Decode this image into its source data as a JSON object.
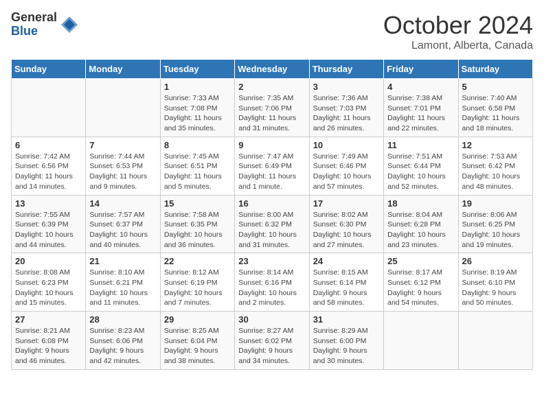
{
  "header": {
    "logo_general": "General",
    "logo_blue": "Blue",
    "month": "October 2024",
    "location": "Lamont, Alberta, Canada"
  },
  "days_of_week": [
    "Sunday",
    "Monday",
    "Tuesday",
    "Wednesday",
    "Thursday",
    "Friday",
    "Saturday"
  ],
  "weeks": [
    [
      {
        "day": "",
        "info": ""
      },
      {
        "day": "",
        "info": ""
      },
      {
        "day": "1",
        "info": "Sunrise: 7:33 AM\nSunset: 7:08 PM\nDaylight: 11 hours\nand 35 minutes."
      },
      {
        "day": "2",
        "info": "Sunrise: 7:35 AM\nSunset: 7:06 PM\nDaylight: 11 hours\nand 31 minutes."
      },
      {
        "day": "3",
        "info": "Sunrise: 7:36 AM\nSunset: 7:03 PM\nDaylight: 11 hours\nand 26 minutes."
      },
      {
        "day": "4",
        "info": "Sunrise: 7:38 AM\nSunset: 7:01 PM\nDaylight: 11 hours\nand 22 minutes."
      },
      {
        "day": "5",
        "info": "Sunrise: 7:40 AM\nSunset: 6:58 PM\nDaylight: 11 hours\nand 18 minutes."
      }
    ],
    [
      {
        "day": "6",
        "info": "Sunrise: 7:42 AM\nSunset: 6:56 PM\nDaylight: 11 hours\nand 14 minutes."
      },
      {
        "day": "7",
        "info": "Sunrise: 7:44 AM\nSunset: 6:53 PM\nDaylight: 11 hours\nand 9 minutes."
      },
      {
        "day": "8",
        "info": "Sunrise: 7:45 AM\nSunset: 6:51 PM\nDaylight: 11 hours\nand 5 minutes."
      },
      {
        "day": "9",
        "info": "Sunrise: 7:47 AM\nSunset: 6:49 PM\nDaylight: 11 hours\nand 1 minute."
      },
      {
        "day": "10",
        "info": "Sunrise: 7:49 AM\nSunset: 6:46 PM\nDaylight: 10 hours\nand 57 minutes."
      },
      {
        "day": "11",
        "info": "Sunrise: 7:51 AM\nSunset: 6:44 PM\nDaylight: 10 hours\nand 52 minutes."
      },
      {
        "day": "12",
        "info": "Sunrise: 7:53 AM\nSunset: 6:42 PM\nDaylight: 10 hours\nand 48 minutes."
      }
    ],
    [
      {
        "day": "13",
        "info": "Sunrise: 7:55 AM\nSunset: 6:39 PM\nDaylight: 10 hours\nand 44 minutes."
      },
      {
        "day": "14",
        "info": "Sunrise: 7:57 AM\nSunset: 6:37 PM\nDaylight: 10 hours\nand 40 minutes."
      },
      {
        "day": "15",
        "info": "Sunrise: 7:58 AM\nSunset: 6:35 PM\nDaylight: 10 hours\nand 36 minutes."
      },
      {
        "day": "16",
        "info": "Sunrise: 8:00 AM\nSunset: 6:32 PM\nDaylight: 10 hours\nand 31 minutes."
      },
      {
        "day": "17",
        "info": "Sunrise: 8:02 AM\nSunset: 6:30 PM\nDaylight: 10 hours\nand 27 minutes."
      },
      {
        "day": "18",
        "info": "Sunrise: 8:04 AM\nSunset: 6:28 PM\nDaylight: 10 hours\nand 23 minutes."
      },
      {
        "day": "19",
        "info": "Sunrise: 8:06 AM\nSunset: 6:25 PM\nDaylight: 10 hours\nand 19 minutes."
      }
    ],
    [
      {
        "day": "20",
        "info": "Sunrise: 8:08 AM\nSunset: 6:23 PM\nDaylight: 10 hours\nand 15 minutes."
      },
      {
        "day": "21",
        "info": "Sunrise: 8:10 AM\nSunset: 6:21 PM\nDaylight: 10 hours\nand 11 minutes."
      },
      {
        "day": "22",
        "info": "Sunrise: 8:12 AM\nSunset: 6:19 PM\nDaylight: 10 hours\nand 7 minutes."
      },
      {
        "day": "23",
        "info": "Sunrise: 8:14 AM\nSunset: 6:16 PM\nDaylight: 10 hours\nand 2 minutes."
      },
      {
        "day": "24",
        "info": "Sunrise: 8:15 AM\nSunset: 6:14 PM\nDaylight: 9 hours\nand 58 minutes."
      },
      {
        "day": "25",
        "info": "Sunrise: 8:17 AM\nSunset: 6:12 PM\nDaylight: 9 hours\nand 54 minutes."
      },
      {
        "day": "26",
        "info": "Sunrise: 8:19 AM\nSunset: 6:10 PM\nDaylight: 9 hours\nand 50 minutes."
      }
    ],
    [
      {
        "day": "27",
        "info": "Sunrise: 8:21 AM\nSunset: 6:08 PM\nDaylight: 9 hours\nand 46 minutes."
      },
      {
        "day": "28",
        "info": "Sunrise: 8:23 AM\nSunset: 6:06 PM\nDaylight: 9 hours\nand 42 minutes."
      },
      {
        "day": "29",
        "info": "Sunrise: 8:25 AM\nSunset: 6:04 PM\nDaylight: 9 hours\nand 38 minutes."
      },
      {
        "day": "30",
        "info": "Sunrise: 8:27 AM\nSunset: 6:02 PM\nDaylight: 9 hours\nand 34 minutes."
      },
      {
        "day": "31",
        "info": "Sunrise: 8:29 AM\nSunset: 6:00 PM\nDaylight: 9 hours\nand 30 minutes."
      },
      {
        "day": "",
        "info": ""
      },
      {
        "day": "",
        "info": ""
      }
    ]
  ]
}
